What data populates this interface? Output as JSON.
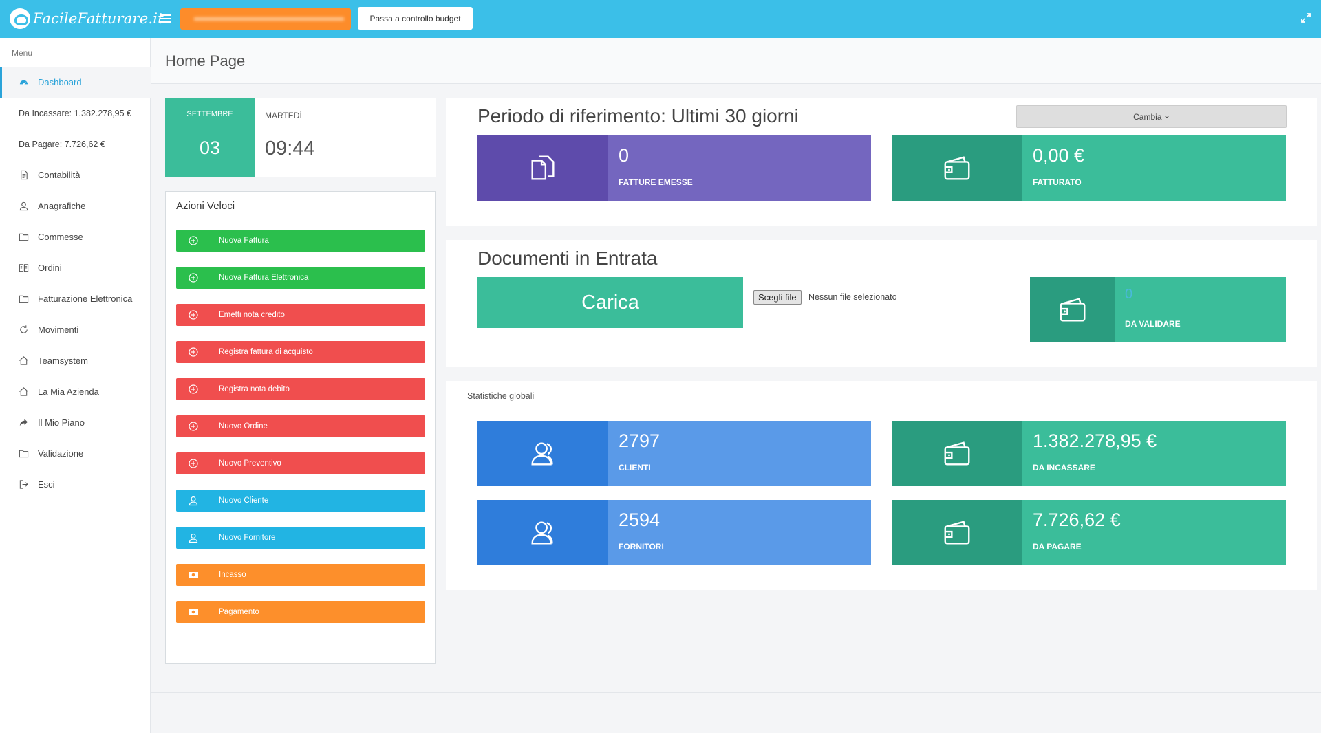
{
  "app": {
    "logo_text": "FacileFatturare.it",
    "budget_button": "Passa a controllo budget"
  },
  "sidebar": {
    "title": "Menu",
    "items": [
      {
        "label": "Dashboard",
        "icon": "dashboard-icon",
        "active": true
      },
      {
        "label": "Da Incassare: 1.382.278,95 €",
        "icon": ""
      },
      {
        "label": "Da Pagare: 7.726,62 €",
        "icon": ""
      },
      {
        "label": "Contabilità",
        "icon": "document-icon"
      },
      {
        "label": "Anagrafiche",
        "icon": "user-icon"
      },
      {
        "label": "Commesse",
        "icon": "folder-icon"
      },
      {
        "label": "Ordini",
        "icon": "book-icon"
      },
      {
        "label": "Fatturazione Elettronica",
        "icon": "folder-icon"
      },
      {
        "label": "Movimenti",
        "icon": "refresh-icon"
      },
      {
        "label": "Teamsystem",
        "icon": "home-icon"
      },
      {
        "label": "La Mia Azienda",
        "icon": "home-icon"
      },
      {
        "label": "Il Mio Piano",
        "icon": "share-icon"
      },
      {
        "label": "Validazione",
        "icon": "folder-icon"
      },
      {
        "label": "Esci",
        "icon": "logout-icon"
      }
    ]
  },
  "header": {
    "title": "Home Page"
  },
  "date_card": {
    "month": "SETTEMBRE",
    "day": "03",
    "weekday": "MARTEDÌ",
    "time": "09:44"
  },
  "quick_actions": {
    "title": "Azioni Veloci",
    "buttons": [
      {
        "label": "Nuova Fattura",
        "color": "#2bbf4d",
        "icon": "plus-circle-icon"
      },
      {
        "label": "Nuova Fattura Elettronica",
        "color": "#2bbf4d",
        "icon": "plus-circle-icon"
      },
      {
        "label": "Emetti nota credito",
        "color": "#f04e4e",
        "icon": "plus-circle-icon"
      },
      {
        "label": "Registra fattura di acquisto",
        "color": "#f04e4e",
        "icon": "plus-circle-icon"
      },
      {
        "label": "Registra nota debito",
        "color": "#f04e4e",
        "icon": "plus-circle-icon"
      },
      {
        "label": "Nuovo Ordine",
        "color": "#f04e4e",
        "icon": "plus-circle-icon"
      },
      {
        "label": "Nuovo Preventivo",
        "color": "#f04e4e",
        "icon": "plus-circle-icon"
      },
      {
        "label": "Nuovo Cliente",
        "color": "#22b4e3",
        "icon": "user-icon"
      },
      {
        "label": "Nuovo Fornitore",
        "color": "#22b4e3",
        "icon": "user-icon"
      },
      {
        "label": "Incasso",
        "color": "#fd8f2b",
        "icon": "money-icon"
      },
      {
        "label": "Pagamento",
        "color": "#fd8f2b",
        "icon": "money-icon"
      }
    ]
  },
  "period": {
    "title": "Periodo di riferimento: Ultimi 30 giorni",
    "change_button": "Cambia",
    "stats": [
      {
        "value": "0",
        "label": "FATTURE EMESSE",
        "icon": "documents-icon"
      },
      {
        "value": "0,00 €",
        "label": "FATTURATO",
        "icon": "wallet-icon"
      }
    ]
  },
  "documents": {
    "title": "Documenti in Entrata",
    "upload_button": "Carica",
    "file_button": "Scegli file",
    "file_status": "Nessun file selezionato",
    "stat": {
      "value": "0",
      "label": "DA VALIDARE",
      "icon": "wallet-icon"
    }
  },
  "global_stats": {
    "title": "Statistiche globali",
    "items": [
      {
        "value": "2797",
        "label": "CLIENTI",
        "icon": "users-icon"
      },
      {
        "value": "1.382.278,95 €",
        "label": "DA INCASSARE",
        "icon": "wallet-icon"
      },
      {
        "value": "2594",
        "label": "FORNITORI",
        "icon": "users-icon"
      },
      {
        "value": "7.726,62 €",
        "label": "DA PAGARE",
        "icon": "wallet-icon"
      }
    ]
  },
  "colors": {
    "topbar": "#3bbfe8",
    "purple_dark": "#5e4bab",
    "purple_light": "#7466bf",
    "teal_dark": "#2a9c7f",
    "teal_light": "#3bbd9a",
    "blue_dark": "#2f7ddb",
    "blue_light": "#5a9ae8"
  }
}
